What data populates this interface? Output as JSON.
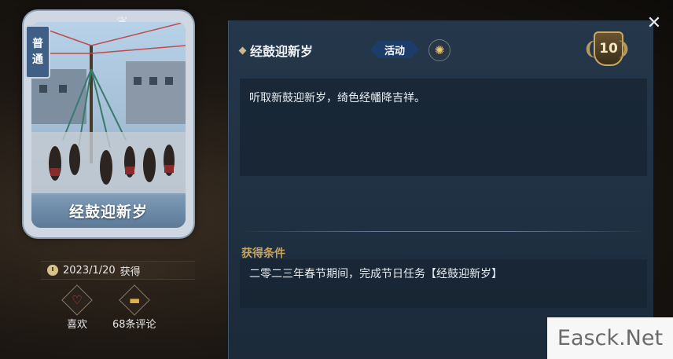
{
  "card": {
    "rarity_line1": "普",
    "rarity_line2": "通",
    "title": "经鼓迎新岁",
    "obtained_date": "2023/1/20",
    "obtained_label": "获得"
  },
  "actions": {
    "like_label": "喜欢",
    "comments_label": "68条评论"
  },
  "detail": {
    "title": "经鼓迎新岁",
    "tag": "活动",
    "level": "10",
    "description": "听取新鼓迎新岁，绮色经幡降吉祥。",
    "condition_label": "获得条件",
    "condition_text": "二零二三年春节期间，完成节日任务【经鼓迎新岁】"
  },
  "close_label": "✕",
  "watermark": "Easck.Net",
  "icons": {
    "close": "close-icon",
    "clock": "clock-icon",
    "heart": "heart-icon",
    "comment": "comment-icon",
    "pinwheel": "pinwheel-icon",
    "level": "laurel-badge-icon"
  }
}
